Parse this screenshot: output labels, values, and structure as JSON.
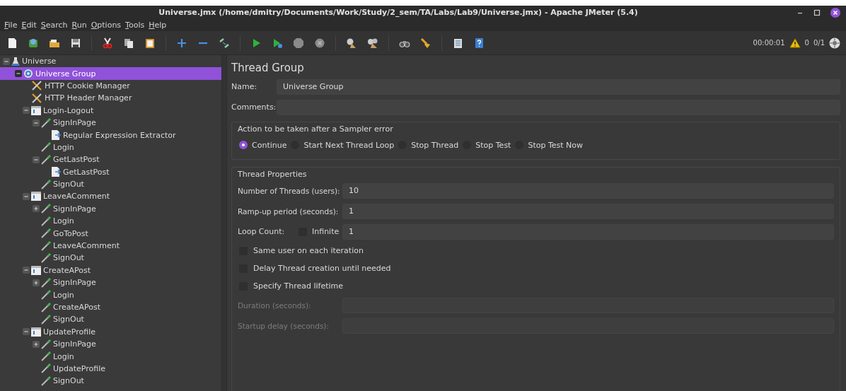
{
  "window": {
    "title": "Universe.jmx (/home/dmitry/Documents/Work/Study/2_sem/TA/Labs/Lab9/Universe.jmx) - Apache JMeter (5.4)"
  },
  "menu": [
    "File",
    "Edit",
    "Search",
    "Run",
    "Options",
    "Tools",
    "Help"
  ],
  "status": {
    "elapsed": "00:00:01",
    "warnings": "0",
    "threads": "0/1"
  },
  "tree": [
    {
      "label": "Universe",
      "kind": "plan",
      "selected": false,
      "expanded": true,
      "children": [
        {
          "label": "Universe Group",
          "kind": "group",
          "selected": true,
          "expanded": true,
          "children": [
            {
              "label": "HTTP Cookie Manager",
              "kind": "config",
              "selected": false
            },
            {
              "label": "HTTP Header Manager",
              "kind": "config",
              "selected": false
            },
            {
              "label": "Login-Logout",
              "kind": "controller",
              "selected": false,
              "expanded": true,
              "children": [
                {
                  "label": "SignInPage",
                  "kind": "sampler",
                  "selected": false,
                  "expanded": true,
                  "children": [
                    {
                      "label": "Regular Expression Extractor",
                      "kind": "extractor",
                      "selected": false
                    }
                  ]
                },
                {
                  "label": "Login",
                  "kind": "sampler",
                  "selected": false
                },
                {
                  "label": "GetLastPost",
                  "kind": "sampler",
                  "selected": false,
                  "expanded": true,
                  "children": [
                    {
                      "label": "GetLastPost",
                      "kind": "extractor",
                      "selected": false
                    }
                  ]
                },
                {
                  "label": "SignOut",
                  "kind": "sampler",
                  "selected": false
                }
              ]
            },
            {
              "label": "LeaveAComment",
              "kind": "controller",
              "selected": false,
              "expanded": true,
              "children": [
                {
                  "label": "SignInPage",
                  "kind": "sampler",
                  "selected": false,
                  "expanded": false
                },
                {
                  "label": "Login",
                  "kind": "sampler",
                  "selected": false
                },
                {
                  "label": "GoToPost",
                  "kind": "sampler",
                  "selected": false
                },
                {
                  "label": "LeaveAComment",
                  "kind": "sampler",
                  "selected": false
                },
                {
                  "label": "SignOut",
                  "kind": "sampler",
                  "selected": false
                }
              ]
            },
            {
              "label": "CreateAPost",
              "kind": "controller",
              "selected": false,
              "expanded": true,
              "children": [
                {
                  "label": "SignInPage",
                  "kind": "sampler",
                  "selected": false,
                  "expanded": false
                },
                {
                  "label": "Login",
                  "kind": "sampler",
                  "selected": false
                },
                {
                  "label": "CreateAPost",
                  "kind": "sampler",
                  "selected": false
                },
                {
                  "label": "SignOut",
                  "kind": "sampler",
                  "selected": false
                }
              ]
            },
            {
              "label": "UpdateProfile",
              "kind": "controller",
              "selected": false,
              "expanded": true,
              "children": [
                {
                  "label": "SignInPage",
                  "kind": "sampler",
                  "selected": false,
                  "expanded": false
                },
                {
                  "label": "Login",
                  "kind": "sampler",
                  "selected": false
                },
                {
                  "label": "UpdateProfile",
                  "kind": "sampler",
                  "selected": false
                },
                {
                  "label": "SignOut",
                  "kind": "sampler",
                  "selected": false
                }
              ]
            }
          ]
        }
      ]
    }
  ],
  "editor": {
    "title": "Thread Group",
    "name_label": "Name:",
    "name_value": "Universe Group",
    "comments_label": "Comments:",
    "error_action": {
      "legend": "Action to be taken after a Sampler error",
      "options": [
        {
          "label": "Continue",
          "selected": true
        },
        {
          "label": "Start Next Thread Loop",
          "selected": false
        },
        {
          "label": "Stop Thread",
          "selected": false
        },
        {
          "label": "Stop Test",
          "selected": false
        },
        {
          "label": "Stop Test Now",
          "selected": false
        }
      ]
    },
    "thread_properties": {
      "legend": "Thread Properties",
      "fields": [
        {
          "label": "Number of Threads (users):",
          "value": "10"
        },
        {
          "label": "Ramp-up period (seconds):",
          "value": "1"
        }
      ],
      "loop_count": {
        "label": "Loop Count:",
        "infinite_label": "Infinite",
        "infinite_checked": false,
        "value": "1"
      },
      "options": [
        {
          "label": "Same user on each iteration",
          "checked": false
        },
        {
          "label": "Delay Thread creation until needed",
          "checked": false
        },
        {
          "label": "Specify Thread lifetime",
          "checked": false
        }
      ],
      "lifetime_fields": [
        {
          "label": "Duration (seconds):",
          "disabled": true
        },
        {
          "label": "Startup delay (seconds):",
          "disabled": true
        }
      ]
    }
  }
}
